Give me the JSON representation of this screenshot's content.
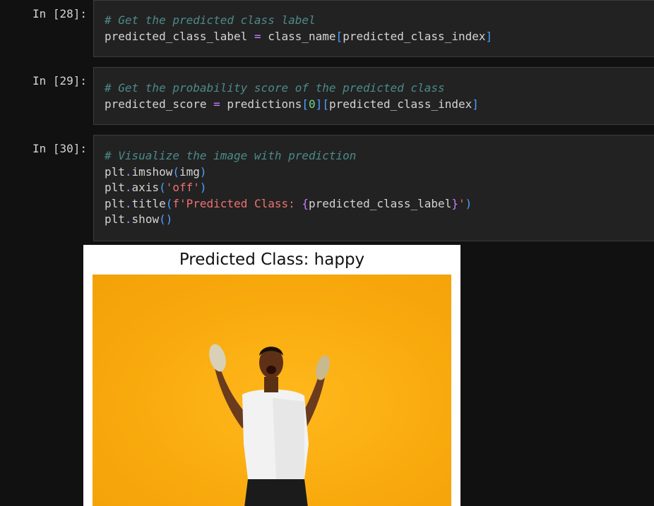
{
  "cells": [
    {
      "prompt": "In [28]:",
      "comment": "# Get the predicted class label",
      "line": {
        "lhs": "predicted_class_label",
        "eq": "=",
        "fn": "class_name",
        "open": "[",
        "arg": "predicted_class_index",
        "close": "]"
      }
    },
    {
      "prompt": "In [29]:",
      "comment": "# Get the probability score of the predicted class",
      "line": {
        "lhs": "predicted_score",
        "eq": "=",
        "obj": "predictions",
        "open1": "[",
        "idx": "0",
        "close1": "]",
        "open2": "[",
        "arg": "predicted_class_index",
        "close2": "]"
      }
    },
    {
      "prompt": "In [30]:",
      "comment": "# Visualize the image with prediction",
      "lines": {
        "imshow": {
          "obj": "plt",
          "dot": ".",
          "fn": "imshow",
          "open": "(",
          "arg": "img",
          "close": ")"
        },
        "axis": {
          "obj": "plt",
          "dot": ".",
          "fn": "axis",
          "open": "(",
          "arg": "'off'",
          "close": ")"
        },
        "title": {
          "obj": "plt",
          "dot": ".",
          "fn": "title",
          "open": "(",
          "str_start": "f'Predicted Class: ",
          "brace_open": "{",
          "var": "predicted_class_label",
          "brace_close": "}",
          "str_end": "'",
          "close": ")"
        },
        "show": {
          "obj": "plt",
          "dot": ".",
          "fn": "show",
          "open": "(",
          "close": ")"
        }
      }
    }
  ],
  "output": {
    "title": "Predicted Class: happy"
  },
  "colors": {
    "background": "#111111",
    "cell_bg": "#222222",
    "comment": "#4d8a8a",
    "operator": "#c77dff",
    "bracket": "#4ba1ff",
    "string": "#f07070",
    "number": "#6fd88a",
    "image_bg": "#f8a90c"
  }
}
